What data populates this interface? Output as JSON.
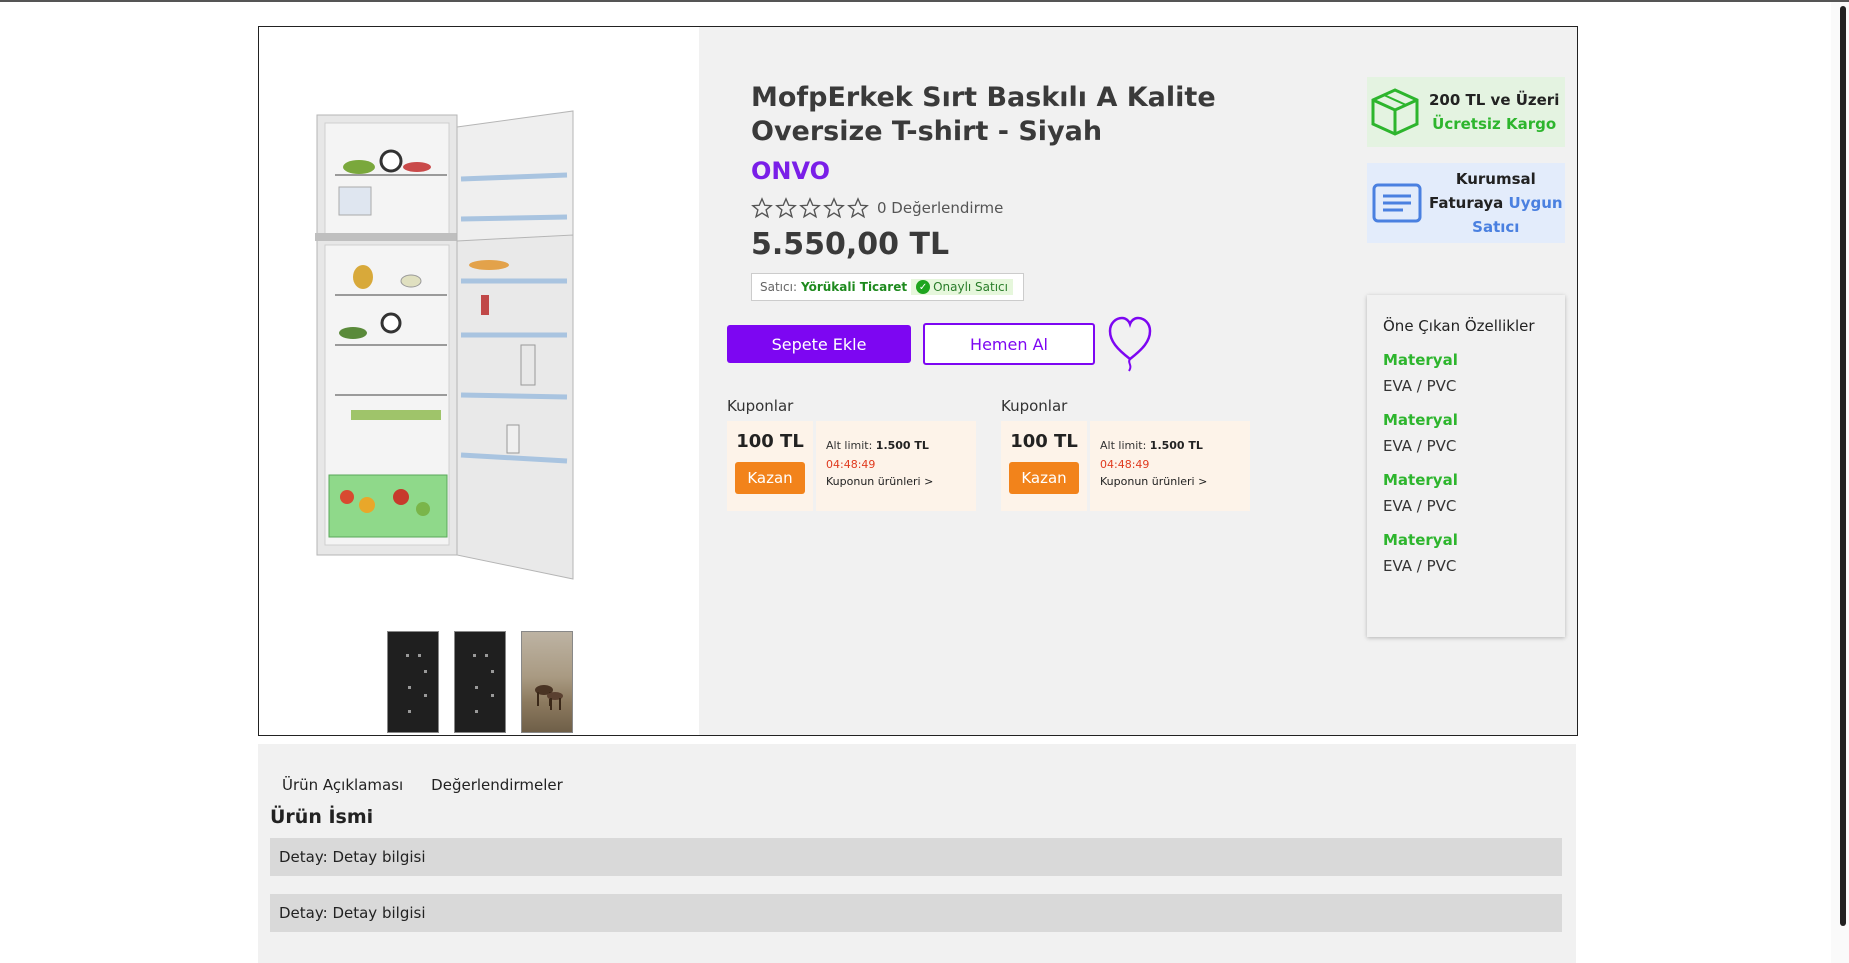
{
  "product": {
    "title": "MofpErkek Sırt Baskılı A Kalite Oversize T-shirt - Siyah",
    "brand": "ONVO",
    "rating_count_text": "0 Değerlendirme",
    "stars_filled": 0,
    "stars_total": 5,
    "price": "5.550,00 TL",
    "seller_label": "Satıcı:",
    "seller_name": "Yörükali Ticaret",
    "seller_badge": "Onaylı Satıcı"
  },
  "actions": {
    "add_to_cart": "Sepete Ekle",
    "buy_now": "Hemen Al"
  },
  "coupons": [
    {
      "label": "Kuponlar",
      "amount": "100 TL",
      "button": "Kazan",
      "limit_label": "Alt limit:",
      "limit_value": "1.500 TL",
      "timer": "04:48:49",
      "link": "Kuponun ürünleri >"
    },
    {
      "label": "Kuponlar",
      "amount": "100 TL",
      "button": "Kazan",
      "limit_label": "Alt limit:",
      "limit_value": "1.500 TL",
      "timer": "04:48:49",
      "link": "Kuponun ürünleri >"
    }
  ],
  "badges": {
    "cargo_line1": "200 TL ve Üzeri",
    "cargo_line2": "Ücretsiz Kargo",
    "invoice_line1": "Kurumsal",
    "invoice_line2a": "Faturaya",
    "invoice_line2b": "Uygun",
    "invoice_line3": "Satıcı"
  },
  "features": {
    "title": "Öne Çıkan Özellikler",
    "items": [
      {
        "name": "Materyal",
        "value": "EVA / PVC"
      },
      {
        "name": "Materyal",
        "value": "EVA / PVC"
      },
      {
        "name": "Materyal",
        "value": "EVA / PVC"
      },
      {
        "name": "Materyal",
        "value": "EVA / PVC"
      }
    ]
  },
  "tabs": [
    "Ürün Açıklaması",
    "Değerlendirmeler"
  ],
  "description": {
    "title": "Ürün İsmi",
    "rows": [
      "Detay: Detay bilgisi",
      "Detay: Detay bilgisi"
    ]
  },
  "colors": {
    "primary": "#7d06f2",
    "coupon_button": "#f2831b",
    "green": "#2db52d",
    "blue": "#4a80e0"
  },
  "icons": [
    "star-outline-icon",
    "heart-balloon-icon",
    "cube-box-icon",
    "document-lines-icon",
    "check-circle-icon"
  ]
}
